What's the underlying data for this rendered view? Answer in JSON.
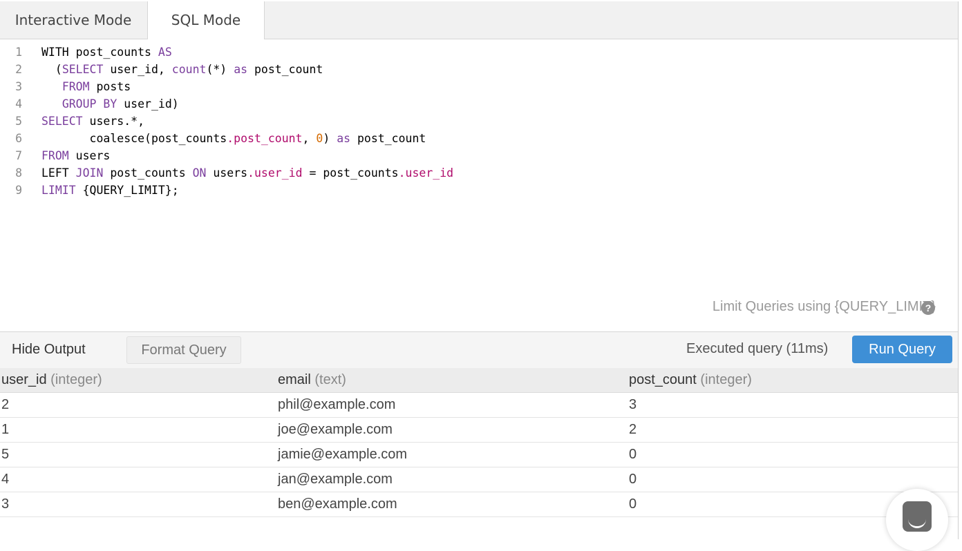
{
  "tabs": [
    {
      "label": "Interactive Mode"
    },
    {
      "label": "SQL Mode"
    }
  ],
  "editor": {
    "line_numbers": [
      "1",
      "2",
      "3",
      "4",
      "5",
      "6",
      "7",
      "8",
      "9"
    ]
  },
  "limit_hint": "Limit Queries using {QUERY_LIMIT}",
  "help_icon_glyph": "?",
  "toolbar": {
    "hide_output": "Hide Output",
    "format_query": "Format Query",
    "status": "Executed query (11ms)",
    "run_query": "Run Query"
  },
  "results": {
    "columns": [
      {
        "name": "user_id",
        "type": "(integer)"
      },
      {
        "name": "email",
        "type": "(text)"
      },
      {
        "name": "post_count",
        "type": "(integer)"
      }
    ],
    "rows": [
      [
        "2",
        "phil@example.com",
        "3"
      ],
      [
        "1",
        "joe@example.com",
        "2"
      ],
      [
        "5",
        "jamie@example.com",
        "0"
      ],
      [
        "4",
        "jan@example.com",
        "0"
      ],
      [
        "3",
        "ben@example.com",
        "0"
      ]
    ]
  },
  "colors": {
    "run_button": "#3e8fd6",
    "keyword": "#7a3e9d",
    "property": "#b00c6c",
    "number": "#d46a00"
  },
  "icons": {
    "help": "question-circle-icon",
    "chat": "chat-icon"
  }
}
